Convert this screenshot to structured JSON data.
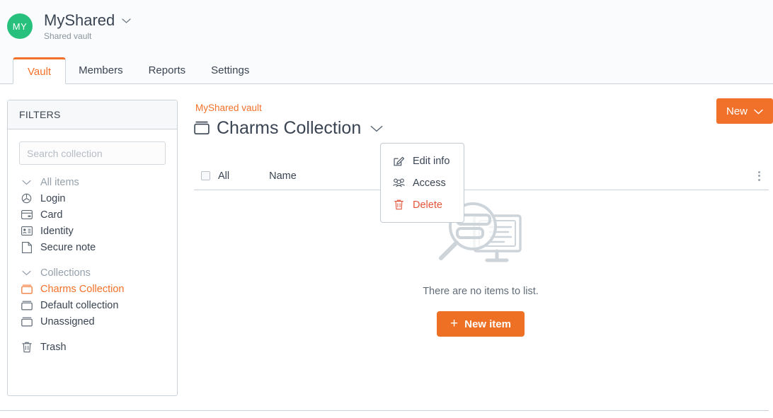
{
  "account": {
    "avatar_initials": "MY",
    "name": "MyShared",
    "subtitle": "Shared vault",
    "chevron_icon": "chevron-down-icon"
  },
  "tabs": [
    {
      "label": "Vault",
      "active": true
    },
    {
      "label": "Members",
      "active": false
    },
    {
      "label": "Reports",
      "active": false
    },
    {
      "label": "Settings",
      "active": false
    }
  ],
  "sidebar": {
    "header": "FILTERS",
    "search": {
      "value": "",
      "placeholder": "Search collection"
    },
    "types": [
      {
        "label": "All items",
        "icon": "chevron-down-icon",
        "active": false,
        "muted": true
      },
      {
        "label": "Login",
        "icon": "globe-icon",
        "active": false,
        "muted": false
      },
      {
        "label": "Card",
        "icon": "card-icon",
        "active": false,
        "muted": false
      },
      {
        "label": "Identity",
        "icon": "identity-icon",
        "active": false,
        "muted": false
      },
      {
        "label": "Secure note",
        "icon": "note-icon",
        "active": false,
        "muted": false
      }
    ],
    "collections": [
      {
        "label": "Collections",
        "icon": "chevron-down-icon",
        "active": false,
        "muted": true
      },
      {
        "label": "Charms Collection",
        "icon": "collection-icon",
        "active": true,
        "muted": false
      },
      {
        "label": "Default collection",
        "icon": "collection-icon",
        "active": false,
        "muted": false
      },
      {
        "label": "Unassigned",
        "icon": "collection-icon",
        "active": false,
        "muted": false
      }
    ],
    "trash": {
      "label": "Trash",
      "icon": "trash-icon"
    }
  },
  "main": {
    "breadcrumb": "MyShared vault",
    "title": "Charms Collection",
    "title_icon": "collection-icon",
    "title_chevron_icon": "chevron-down-icon",
    "new_button": {
      "label": "New",
      "icon": "chevron-down-icon"
    },
    "list_header": {
      "select_all_label": "All",
      "name_column": "Name",
      "kebab_icon": "more-vertical-icon"
    },
    "empty_state": {
      "illustration": "magnifier-over-monitor-illustration",
      "message": "There are no items to list.",
      "button_label": "New item",
      "button_icon": "plus-icon"
    }
  },
  "menu": {
    "items": [
      {
        "label": "Edit info",
        "icon": "edit-icon",
        "danger": false
      },
      {
        "label": "Access",
        "icon": "people-icon",
        "danger": false
      },
      {
        "label": "Delete",
        "icon": "trash-icon",
        "danger": true
      }
    ]
  },
  "colors": {
    "accent": "#f2712a",
    "accent_button": "#ee7024",
    "danger": "#e2543a",
    "avatar_green": "#27c17d",
    "text": "#3a4452",
    "muted": "#95a0aa",
    "border": "#ccd2d9"
  }
}
